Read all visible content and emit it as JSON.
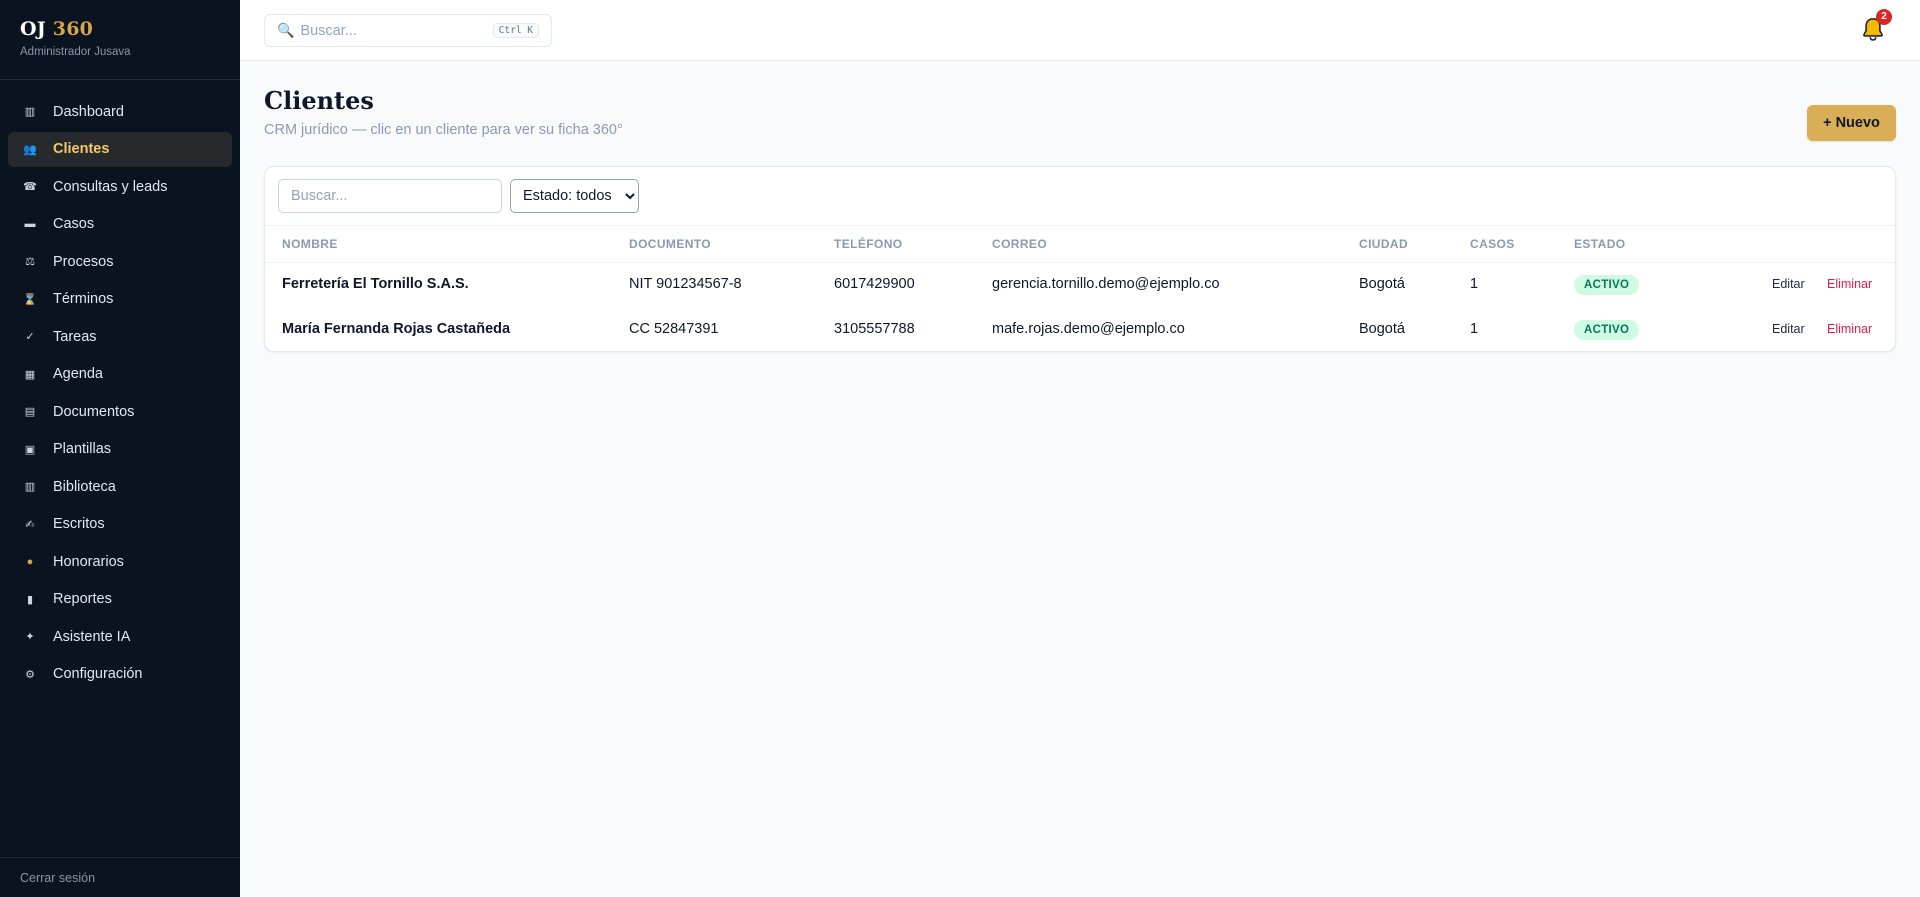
{
  "brand": {
    "name": "OJ",
    "accent": "360",
    "subtitle": "Administrador Jusava"
  },
  "sidebar": {
    "items": [
      {
        "label": "Dashboard",
        "icon": "▥"
      },
      {
        "label": "Clientes",
        "icon": "👥",
        "active": true
      },
      {
        "label": "Consultas y leads",
        "icon": "☎"
      },
      {
        "label": "Casos",
        "icon": "▬"
      },
      {
        "label": "Procesos",
        "icon": "⚖"
      },
      {
        "label": "Términos",
        "icon": "⌛"
      },
      {
        "label": "Tareas",
        "icon": "✓"
      },
      {
        "label": "Agenda",
        "icon": "▦"
      },
      {
        "label": "Documentos",
        "icon": "▤"
      },
      {
        "label": "Plantillas",
        "icon": "▣"
      },
      {
        "label": "Biblioteca",
        "icon": "▥"
      },
      {
        "label": "Escritos",
        "icon": "✍"
      },
      {
        "label": "Honorarios",
        "icon": "●"
      },
      {
        "label": "Reportes",
        "icon": "▮"
      },
      {
        "label": "Asistente IA",
        "icon": "✦"
      },
      {
        "label": "Configuración",
        "icon": "⚙"
      }
    ],
    "logout": "Cerrar sesión"
  },
  "topbar": {
    "search_placeholder": "Buscar...",
    "shortcut": "Ctrl K",
    "notifications_count": "2"
  },
  "page": {
    "title": "Clientes",
    "subtitle": "CRM jurídico — clic en un cliente para ver su ficha 360°",
    "new_button": "+ Nuevo"
  },
  "filters": {
    "search_placeholder": "Buscar...",
    "status_selected": "Estado: todos"
  },
  "table": {
    "headers": {
      "nombre": "NOMBRE",
      "documento": "DOCUMENTO",
      "telefono": "TELÉFONO",
      "correo": "CORREO",
      "ciudad": "CIUDAD",
      "casos": "CASOS",
      "estado": "ESTADO"
    },
    "rows": [
      {
        "nombre": "Ferretería El Tornillo S.A.S.",
        "documento": "NIT 901234567-8",
        "telefono": "6017429900",
        "correo": "gerencia.tornillo.demo@ejemplo.co",
        "ciudad": "Bogotá",
        "casos": "1",
        "estado": "ACTIVO",
        "edit": "Editar",
        "delete": "Eliminar"
      },
      {
        "nombre": "María Fernanda Rojas Castañeda",
        "documento": "CC 52847391",
        "telefono": "3105557788",
        "correo": "mafe.rojas.demo@ejemplo.co",
        "ciudad": "Bogotá",
        "casos": "1",
        "estado": "ACTIVO",
        "edit": "Editar",
        "delete": "Eliminar"
      }
    ]
  },
  "colors": {
    "sidebar_bg": "#0b1220",
    "accent_gold": "#d9ae56",
    "active_text": "#f5c96a",
    "status_active_bg": "#d1fae5",
    "status_active_text": "#047857",
    "delete_red": "#e11d48",
    "badge_red": "#dc2626"
  }
}
